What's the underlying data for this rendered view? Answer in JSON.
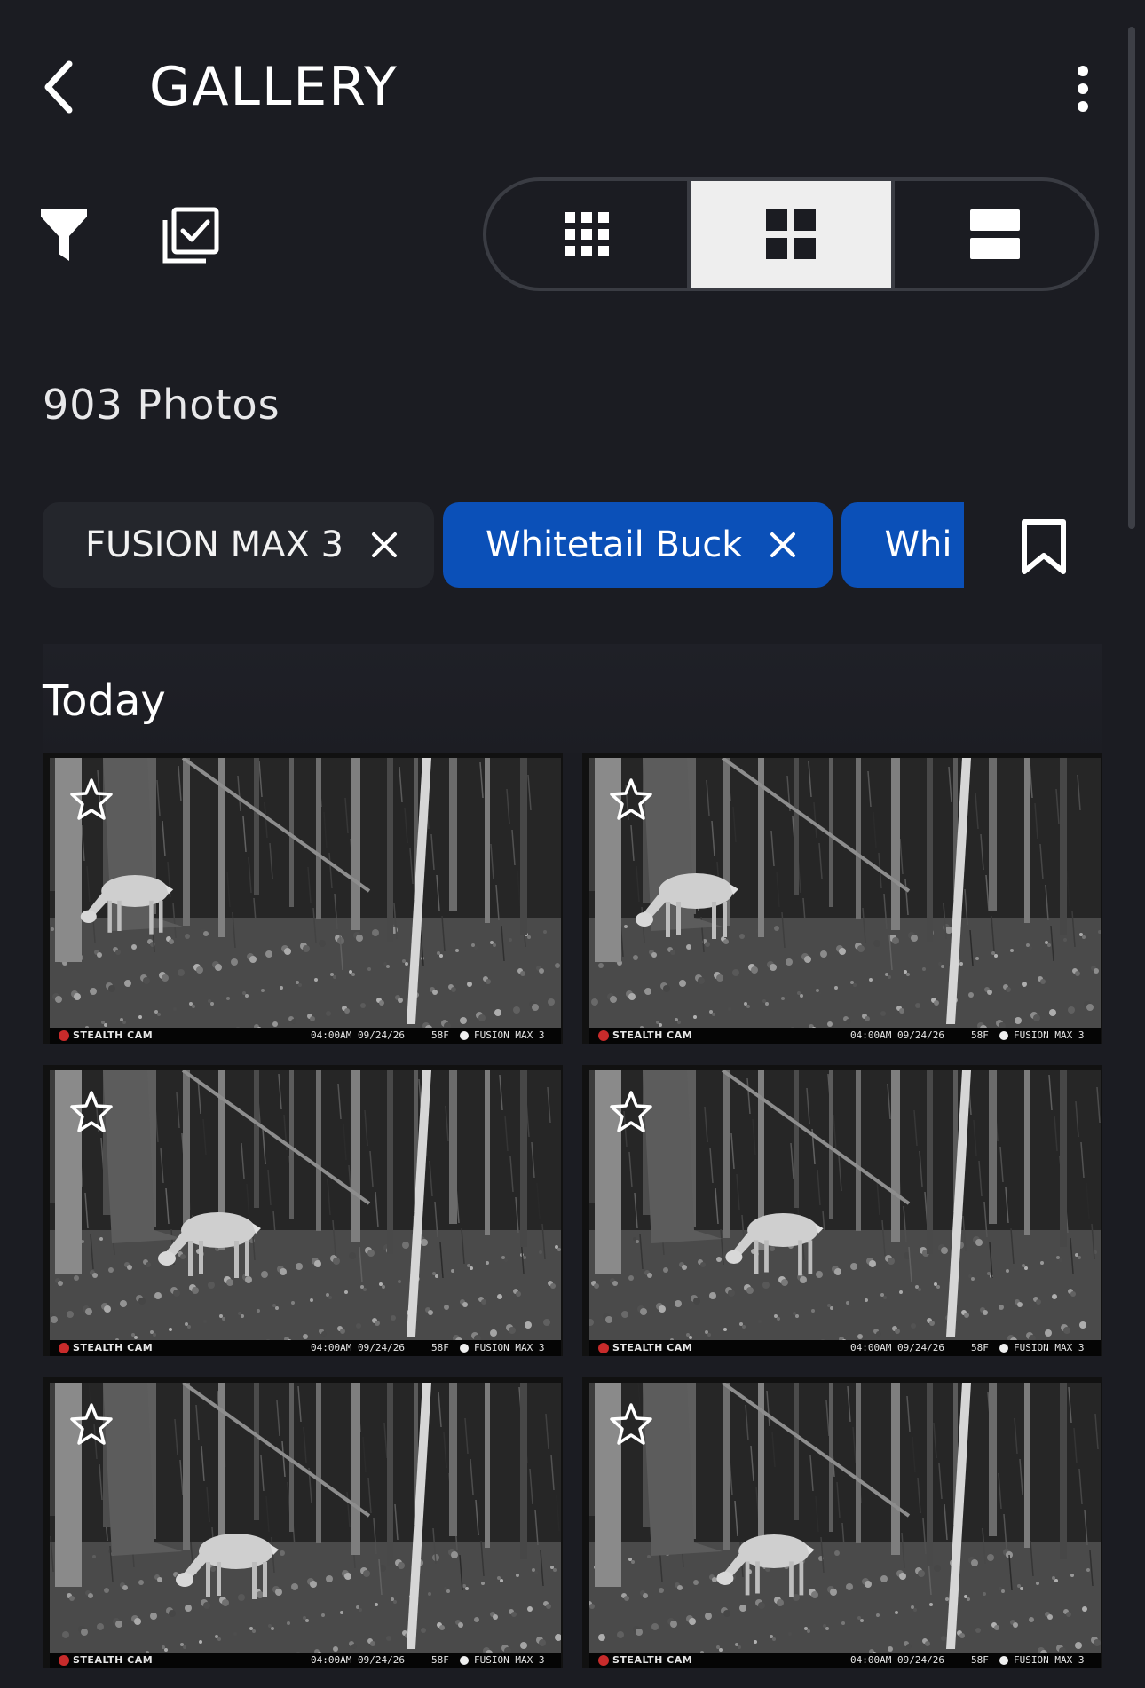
{
  "header": {
    "title": "GALLERY",
    "back_icon": "chevron-left-icon",
    "more_icon": "more-vertical-icon"
  },
  "toolbar": {
    "filter_icon": "filter-icon",
    "select_icon": "select-all-icon",
    "view_modes": [
      {
        "name": "small-grid",
        "icon": "grid-3x3-icon",
        "active": false
      },
      {
        "name": "medium-grid",
        "icon": "grid-2x2-icon",
        "active": true
      },
      {
        "name": "list",
        "icon": "rows-icon",
        "active": false
      }
    ]
  },
  "count_label": "903 Photos",
  "filter_chips": [
    {
      "label": "FUSION MAX 3",
      "style": "dark"
    },
    {
      "label": "Whitetail Buck",
      "style": "blue"
    },
    {
      "label": "Whi",
      "style": "blue"
    }
  ],
  "bookmark_icon": "bookmark-icon",
  "section": {
    "title": "Today"
  },
  "photos": [
    {
      "brand": "STEALTH CAM",
      "time": "04:00AM 09/24/26",
      "temp": "58F",
      "model": "FUSION MAX 3",
      "favorite": false
    },
    {
      "brand": "STEALTH CAM",
      "time": "04:00AM 09/24/26",
      "temp": "58F",
      "model": "FUSION MAX 3",
      "favorite": false
    },
    {
      "brand": "STEALTH CAM",
      "time": "04:00AM 09/24/26",
      "temp": "58F",
      "model": "FUSION MAX 3",
      "favorite": false
    },
    {
      "brand": "STEALTH CAM",
      "time": "04:00AM 09/24/26",
      "temp": "58F",
      "model": "FUSION MAX 3",
      "favorite": false
    },
    {
      "brand": "STEALTH CAM",
      "time": "04:00AM 09/24/26",
      "temp": "58F",
      "model": "FUSION MAX 3",
      "favorite": false
    },
    {
      "brand": "STEALTH CAM",
      "time": "04:00AM 09/24/26",
      "temp": "58F",
      "model": "FUSION MAX 3",
      "favorite": false
    }
  ],
  "colors": {
    "background": "#1b1c22",
    "chip_blue": "#0b50b8",
    "chip_dark": "#24262c",
    "toggle_active": "#eeeeee"
  }
}
